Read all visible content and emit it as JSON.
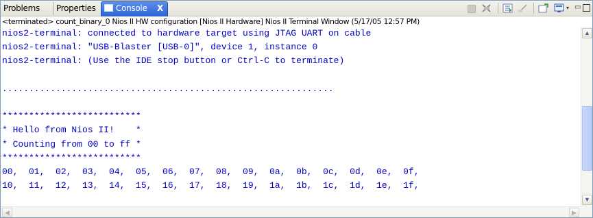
{
  "tabs": {
    "problems": "Problems",
    "properties": "Properties",
    "console": "Console",
    "close_glyph": "X"
  },
  "toolbar": {
    "icons": [
      "stop-icon",
      "remove-launch-icon",
      "scroll-lock-icon",
      "pin-console-icon",
      "open-console-icon",
      "display-console-icon",
      "view-menu-icon",
      "minimize-icon",
      "maximize-icon"
    ],
    "dropdown_glyph": "▾",
    "min_glyph": "▭"
  },
  "status_line": "<terminated> count_binary_0 Nios II HW configuration [Nios II Hardware] Nios II Terminal Window (5/17/05 12:57 PM)",
  "console_lines": [
    "nios2-terminal: connected to hardware target using JTAG UART on cable",
    "nios2-terminal: \"USB-Blaster [USB-0]\", device 1, instance 0",
    "nios2-terminal: (Use the IDE stop button or Ctrl-C to terminate)",
    "",
    "..............................................................",
    "",
    "**************************",
    "* Hello from Nios II!    *",
    "* Counting from 00 to ff *",
    "**************************",
    "00,  01,  02,  03,  04,  05,  06,  07,  08,  09,  0a,  0b,  0c,  0d,  0e,  0f,",
    "10,  11,  12,  13,  14,  15,  16,  17,  18,  19,  1a,  1b,  1c,  1d,  1e,  1f,"
  ],
  "colors": {
    "console_text": "#0000c0",
    "active_tab": "#2f64d4"
  }
}
